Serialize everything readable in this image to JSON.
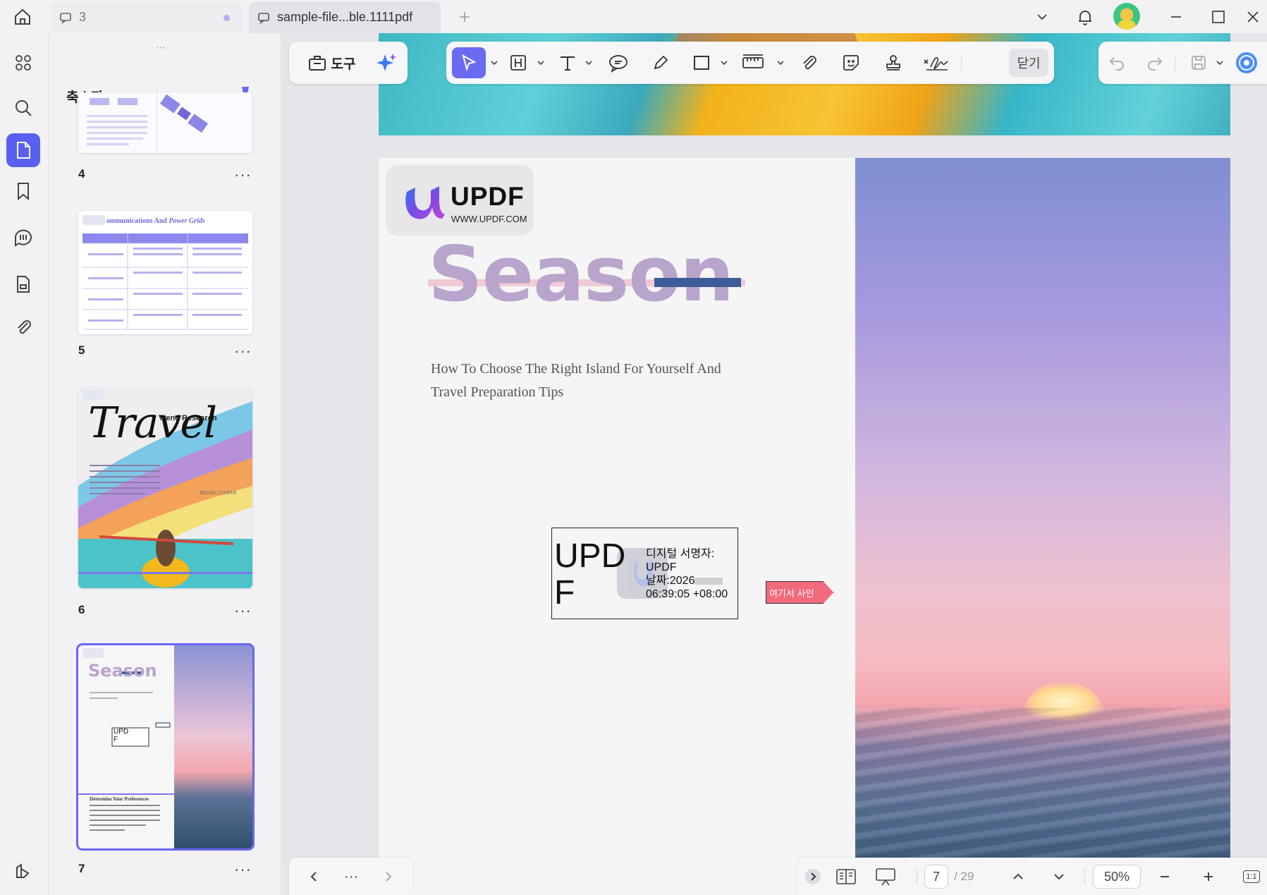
{
  "titlebar": {
    "tabs": [
      {
        "type": "comments",
        "count": "3"
      },
      {
        "type": "document",
        "name": "sample-file...ble.1111pdf"
      }
    ]
  },
  "rail": {
    "items": [
      {
        "name": "overview",
        "icon": "grid-icon"
      },
      {
        "name": "search",
        "icon": "search-icon"
      },
      {
        "name": "thumbnails",
        "icon": "page-icon",
        "active": true
      },
      {
        "name": "bookmarks",
        "icon": "bookmark-icon"
      },
      {
        "name": "comments",
        "icon": "comment-list-icon"
      },
      {
        "name": "forms",
        "icon": "form-icon"
      },
      {
        "name": "attachments",
        "icon": "paperclip-icon"
      }
    ]
  },
  "thumbnails": {
    "title": "축소판",
    "pages": [
      {
        "number": "4"
      },
      {
        "number": "5",
        "heading": "ommunications And",
        "heading_italic": "Power Grids"
      },
      {
        "number": "6",
        "heading": "Trend Research",
        "script": "Travel",
        "author": "BESSIE COOPER"
      },
      {
        "number": "7",
        "selected": true,
        "season": "Season",
        "sig": "UPD\nF",
        "section": "Determine Your Preferences"
      }
    ],
    "more": "···"
  },
  "toolbar": {
    "tools_label": "도구",
    "close_label": "닫기"
  },
  "document": {
    "logo": {
      "name": "UPDF",
      "url": "WWW.UPDF.COM"
    },
    "title": "Season",
    "subtitle": "How To Choose The Right Island For Yourself And Travel Preparation Tips",
    "signature": {
      "name": "UPD\nF",
      "line1": "디지털 서명자:",
      "line2": "UPDF",
      "line3": "날짜:2026",
      "line4": "06:39:05 +08:00"
    },
    "sign_here": "여기서 사인"
  },
  "bottom_nav": {
    "more": "···"
  },
  "status": {
    "current_page": "7",
    "total_pages": "/ 29",
    "zoom": "50%",
    "fit_label": "1:1"
  },
  "colors": {
    "accent": "#5b5ff0",
    "season_text": "#b9a4cc",
    "strike_blue": "#3d5d98",
    "sign_here_bg": "#f26b7d"
  }
}
